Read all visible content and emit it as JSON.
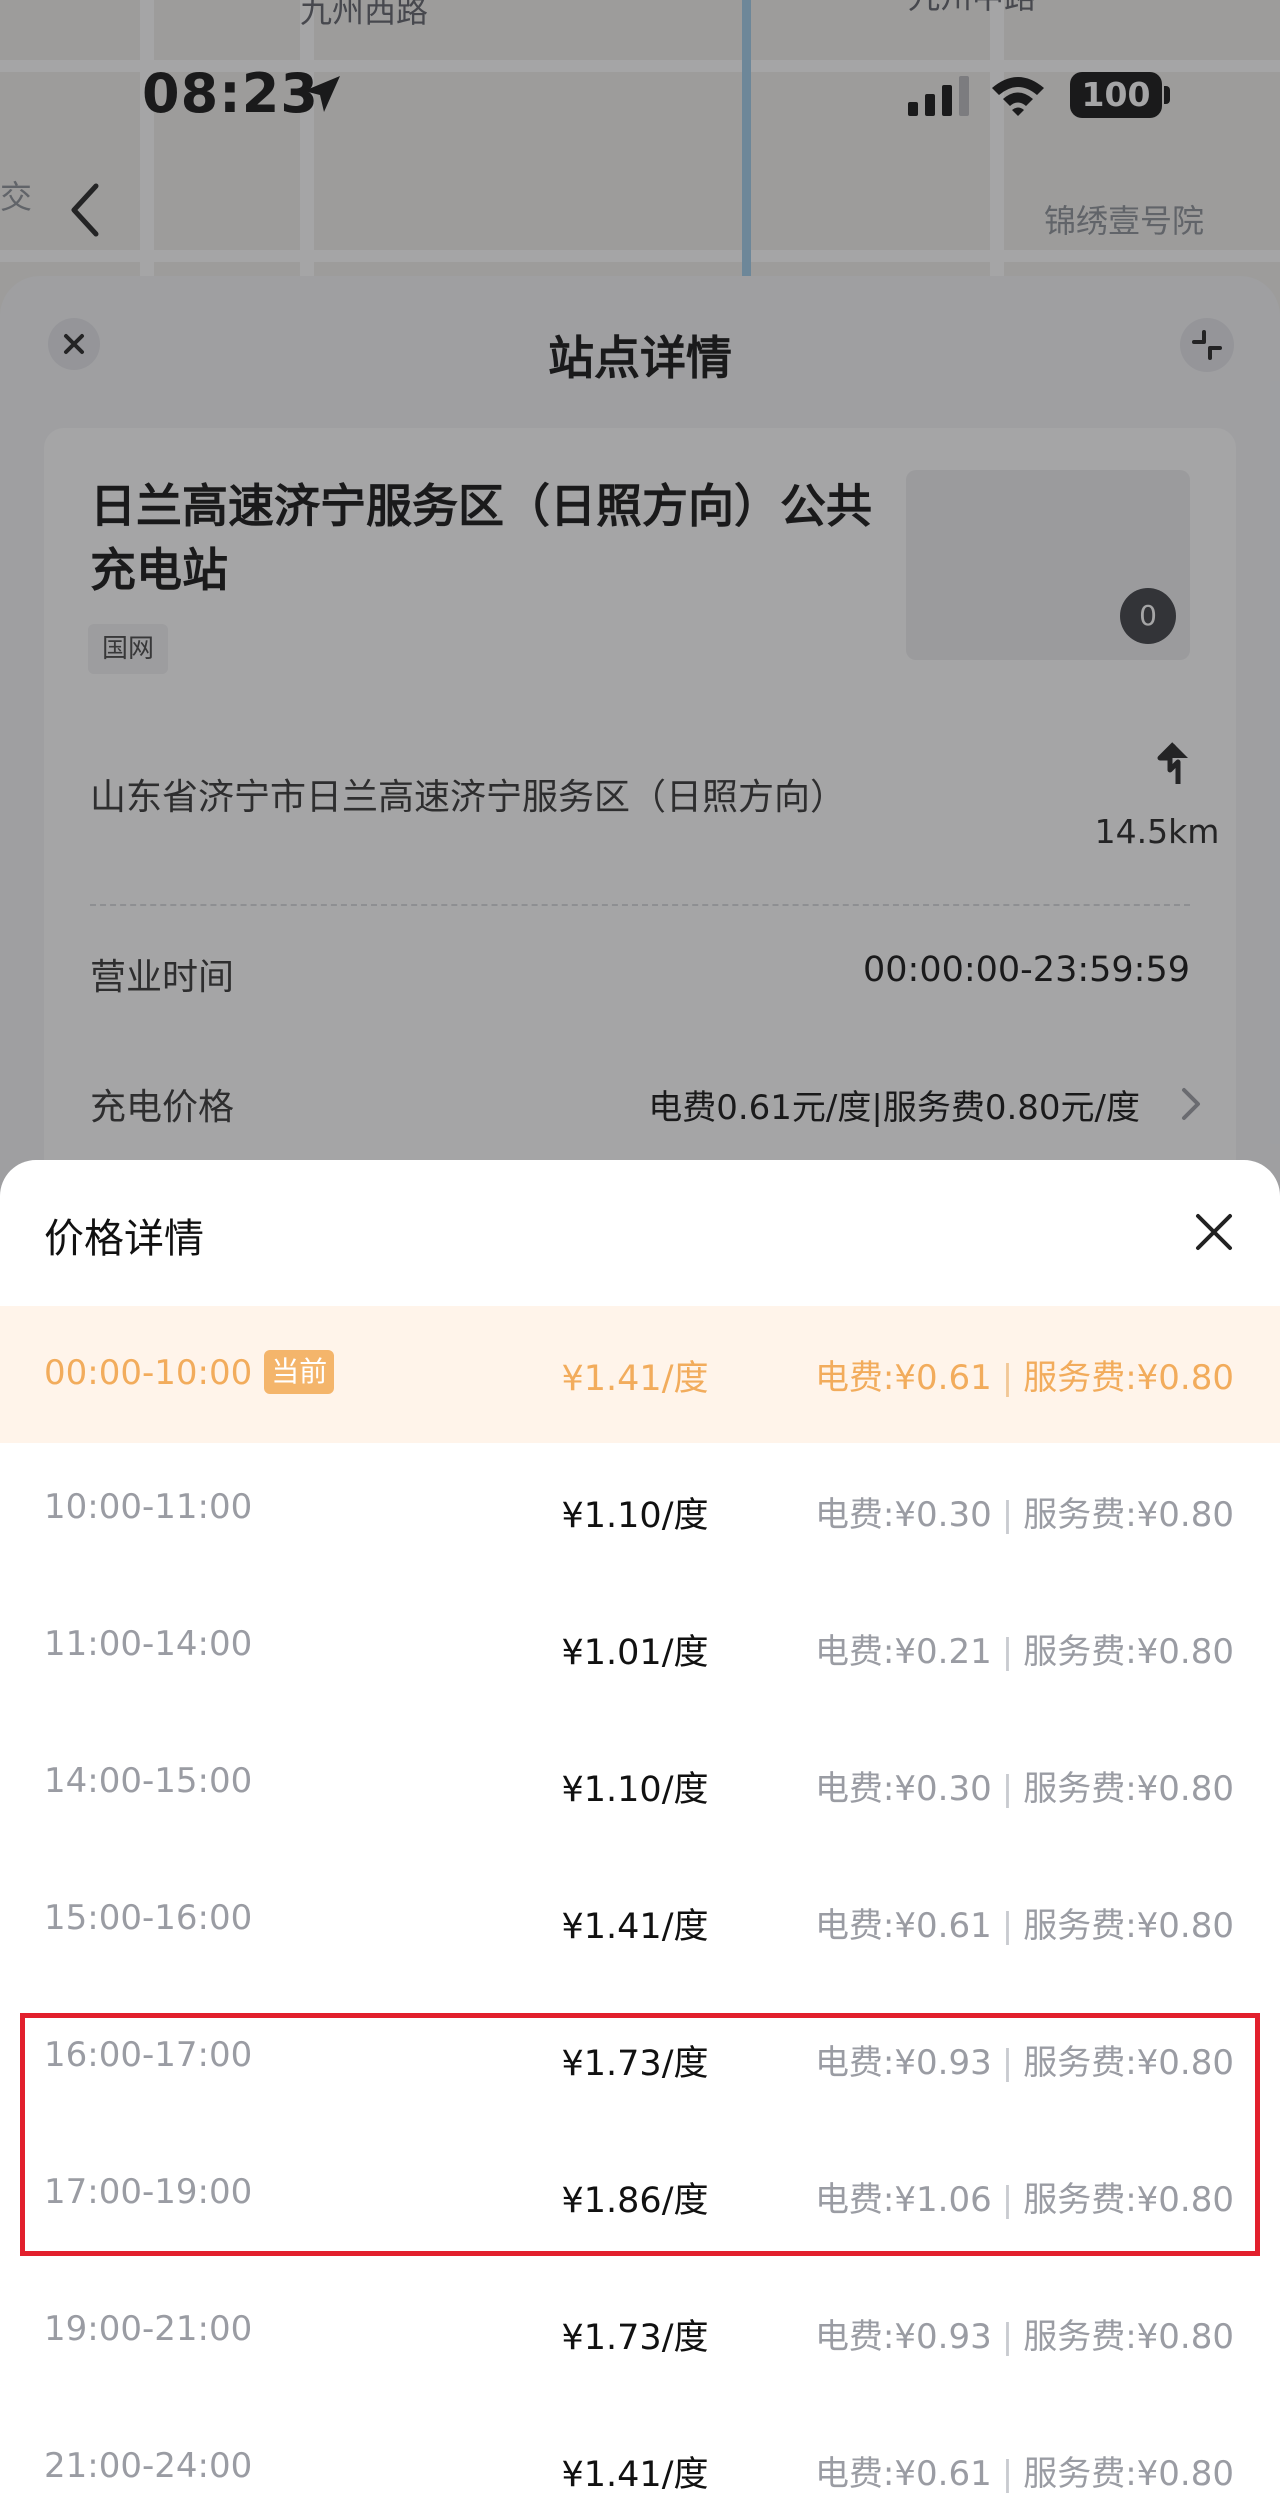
{
  "map": {
    "road_left": "九州西路",
    "road_right": "九州中路",
    "poi_left": "交",
    "poi_right": "锦绣壹号院"
  },
  "status_bar": {
    "time": "08:23",
    "battery": "100"
  },
  "sheet": {
    "title": "站点详情",
    "station_name": "日兰高速济宁服务区（日照方向）公共充电站",
    "operator_tag": "国网",
    "photo_count": "0",
    "address": "山东省济宁市日兰高速济宁服务区（日照方向）",
    "distance": "14.5km",
    "hours_label": "营业时间",
    "hours_value": "00:00:00-23:59:59",
    "price_label": "充电价格",
    "price_summary": "电费0.61元/度|服务费0.80元/度"
  },
  "price_popup": {
    "title": "价格详情",
    "current_badge": "当前",
    "rows": [
      {
        "time": "00:00-10:00",
        "unit_price": "¥1.41/度",
        "electricity_fee": "电费:¥0.61",
        "service_fee": "服务费:¥0.80",
        "current": true
      },
      {
        "time": "10:00-11:00",
        "unit_price": "¥1.10/度",
        "electricity_fee": "电费:¥0.30",
        "service_fee": "服务费:¥0.80",
        "current": false
      },
      {
        "time": "11:00-14:00",
        "unit_price": "¥1.01/度",
        "electricity_fee": "电费:¥0.21",
        "service_fee": "服务费:¥0.80",
        "current": false
      },
      {
        "time": "14:00-15:00",
        "unit_price": "¥1.10/度",
        "electricity_fee": "电费:¥0.30",
        "service_fee": "服务费:¥0.80",
        "current": false
      },
      {
        "time": "15:00-16:00",
        "unit_price": "¥1.41/度",
        "electricity_fee": "电费:¥0.61",
        "service_fee": "服务费:¥0.80",
        "current": false
      },
      {
        "time": "16:00-17:00",
        "unit_price": "¥1.73/度",
        "electricity_fee": "电费:¥0.93",
        "service_fee": "服务费:¥0.80",
        "current": false
      },
      {
        "time": "17:00-19:00",
        "unit_price": "¥1.86/度",
        "electricity_fee": "电费:¥1.06",
        "service_fee": "服务费:¥0.80",
        "current": false
      },
      {
        "time": "19:00-21:00",
        "unit_price": "¥1.73/度",
        "electricity_fee": "电费:¥0.93",
        "service_fee": "服务费:¥0.80",
        "current": false
      },
      {
        "time": "21:00-24:00",
        "unit_price": "¥1.41/度",
        "electricity_fee": "电费:¥0.61",
        "service_fee": "服务费:¥0.80",
        "current": false
      }
    ]
  },
  "colors": {
    "current_row_text": "#f2ac5c",
    "current_row_bg": "#fff4ea",
    "highlight_border": "#e2202d"
  }
}
